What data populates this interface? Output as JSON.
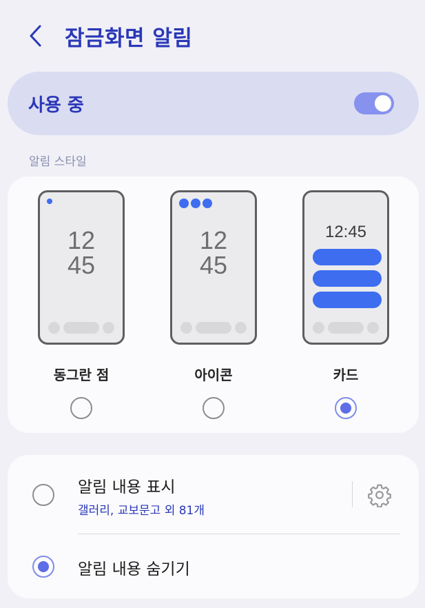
{
  "header": {
    "title": "잠금화면 알림",
    "back_icon": "chevron-left-icon"
  },
  "master": {
    "label": "사용 중",
    "enabled": true,
    "accent_color": "#8791ee"
  },
  "style_section": {
    "label": "알림 스타일",
    "options": [
      {
        "label": "동그란 점",
        "preview": "dot",
        "clock": [
          "12",
          "45"
        ],
        "selected": false
      },
      {
        "label": "아이콘",
        "preview": "icons",
        "clock": [
          "12",
          "45"
        ],
        "selected": false
      },
      {
        "label": "카드",
        "preview": "card",
        "clock": "12:45",
        "selected": true
      }
    ]
  },
  "content_section": {
    "show": {
      "title": "알림 내용 표시",
      "subtitle": "갤러리, 교보문고 외 81개",
      "selected": false,
      "settings_icon": "gear-icon"
    },
    "hide": {
      "title": "알림 내용 숨기기",
      "selected": true
    }
  },
  "colors": {
    "brand": "#2a37b8",
    "preview_accent": "#3e6df0",
    "radio_selected": "#5d6de6"
  }
}
